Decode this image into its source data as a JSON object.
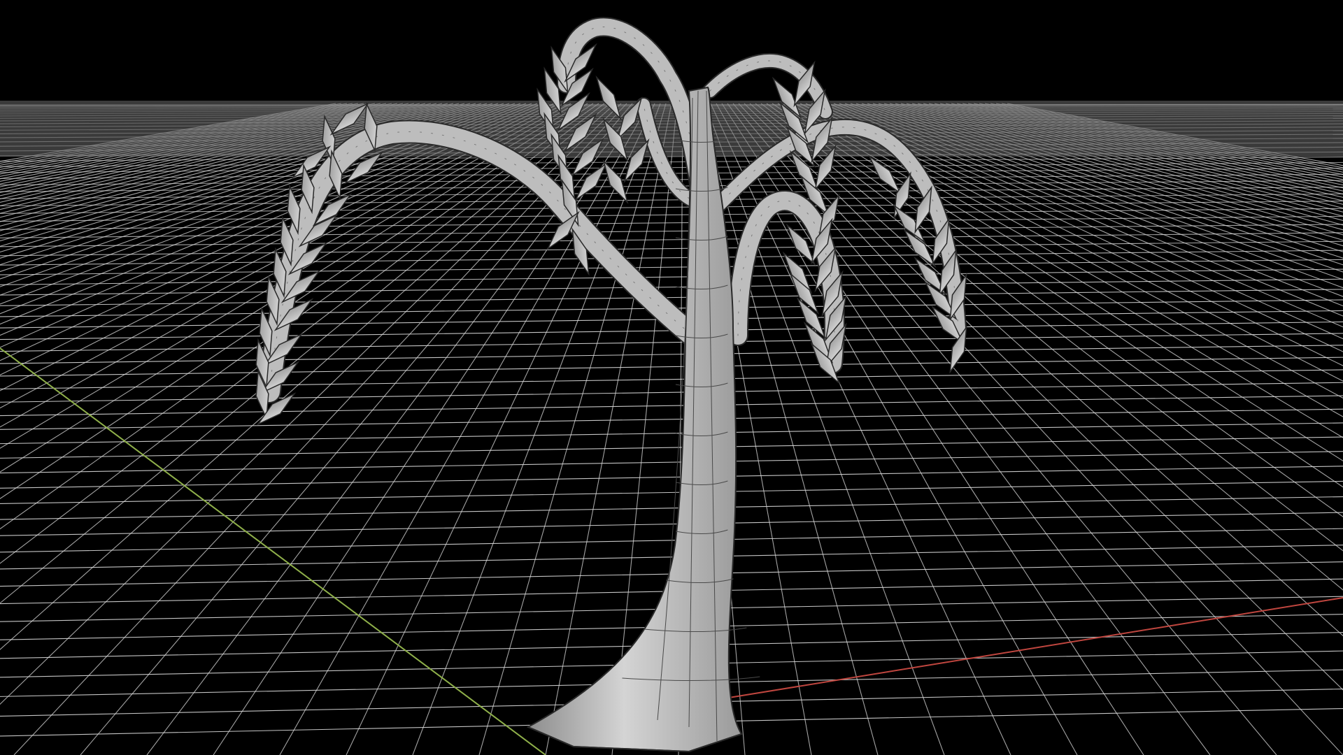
{
  "viewport": {
    "background_color": "#000000",
    "grid_color": "#d9d9d9",
    "x_axis_color": "#c0463f",
    "y_axis_color": "#8fb04a",
    "mesh_fill_color": "#bdbdbd",
    "mesh_wire_color": "#2a2a2a",
    "leaf_fill_color": "#c4c4c4"
  },
  "scene": {
    "object_name": "",
    "object_type": "tree-mesh",
    "shading": "solid",
    "show_wireframe": true,
    "show_grid_floor": true
  }
}
